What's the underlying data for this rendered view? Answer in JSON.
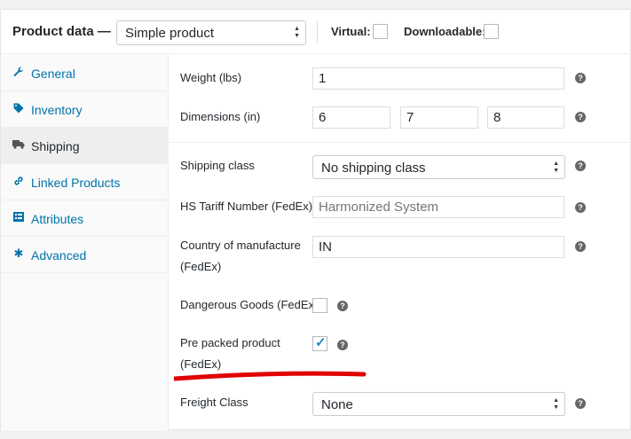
{
  "header": {
    "title": "Product data —",
    "product_type": "Simple product",
    "virtual_label": "Virtual:",
    "downloadable_label": "Downloadable:"
  },
  "sidebar": {
    "items": [
      {
        "label": "General",
        "icon": "wrench-icon"
      },
      {
        "label": "Inventory",
        "icon": "tag-icon"
      },
      {
        "label": "Shipping",
        "icon": "truck-icon",
        "active": true
      },
      {
        "label": "Linked Products",
        "icon": "link-icon"
      },
      {
        "label": "Attributes",
        "icon": "list-icon"
      },
      {
        "label": "Advanced",
        "icon": "gear-icon"
      }
    ]
  },
  "form": {
    "weight_label": "Weight (lbs)",
    "weight_value": "1",
    "dimensions_label": "Dimensions (in)",
    "length_value": "6",
    "width_value": "7",
    "height_value": "8",
    "shipping_class_label": "Shipping class",
    "shipping_class_value": "No shipping class",
    "hs_tariff_label": "HS Tariff Number (FedEx)",
    "hs_tariff_placeholder": "Harmonized System",
    "country_label_1": "Country of manufacture",
    "country_label_2": "(FedEx)",
    "country_value": "IN",
    "dangerous_label": "Dangerous Goods (FedEx)",
    "dangerous_checked": false,
    "prepacked_label_1": "Pre packed product",
    "prepacked_label_2": "(FedEx)",
    "prepacked_checked": true,
    "freight_label": "Freight Class",
    "freight_value": "None"
  },
  "colors": {
    "link": "#0073aa",
    "annotation": "#e00000",
    "checkmark": "#1e8cbe"
  }
}
